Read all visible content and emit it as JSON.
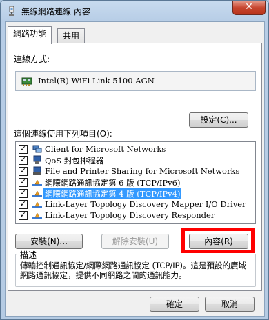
{
  "window": {
    "title": "無線網路連線 內容",
    "close": "✕"
  },
  "tabs": [
    {
      "label": "網路功能"
    },
    {
      "label": "共用"
    }
  ],
  "connect_using_label": "連線方式:",
  "adapter_name": "Intel(R) WiFi Link 5100 AGN",
  "configure_button": "設定(C)...",
  "items_label": "這個連線使用下列項目(O):",
  "items": [
    {
      "label": "Client for Microsoft Networks",
      "checked": true,
      "icon": "network-client-icon"
    },
    {
      "label": "QoS 封包排程器",
      "checked": true,
      "icon": "qos-scheduler-icon"
    },
    {
      "label": "File and Printer Sharing for Microsoft Networks",
      "checked": true,
      "icon": "printer-sharing-icon"
    },
    {
      "label": "網際網路通訊協定第 6 版 (TCP/IPv6)",
      "checked": true,
      "icon": "protocol-icon"
    },
    {
      "label": "網際網路通訊協定第 4 版 (TCP/IPv4)",
      "checked": true,
      "icon": "protocol-icon",
      "selected": true
    },
    {
      "label": "Link-Layer Topology Discovery Mapper I/O Driver",
      "checked": true,
      "icon": "protocol-icon"
    },
    {
      "label": "Link-Layer Topology Discovery Responder",
      "checked": true,
      "icon": "protocol-icon"
    }
  ],
  "install_button": "安裝(N)...",
  "uninstall_button": "解除安裝(U)",
  "properties_button": "內容(R)",
  "description_label": "描述",
  "description_text": "傳輸控制通訊協定/網際網路通訊協定 (TCP/IP)。這是預設的廣域網路通訊協定，提供不同網路之間的通訊能力。",
  "ok_button": "確定",
  "cancel_button": "取消",
  "colors": {
    "highlight": "#ff0000",
    "selection": "#3399ff"
  }
}
